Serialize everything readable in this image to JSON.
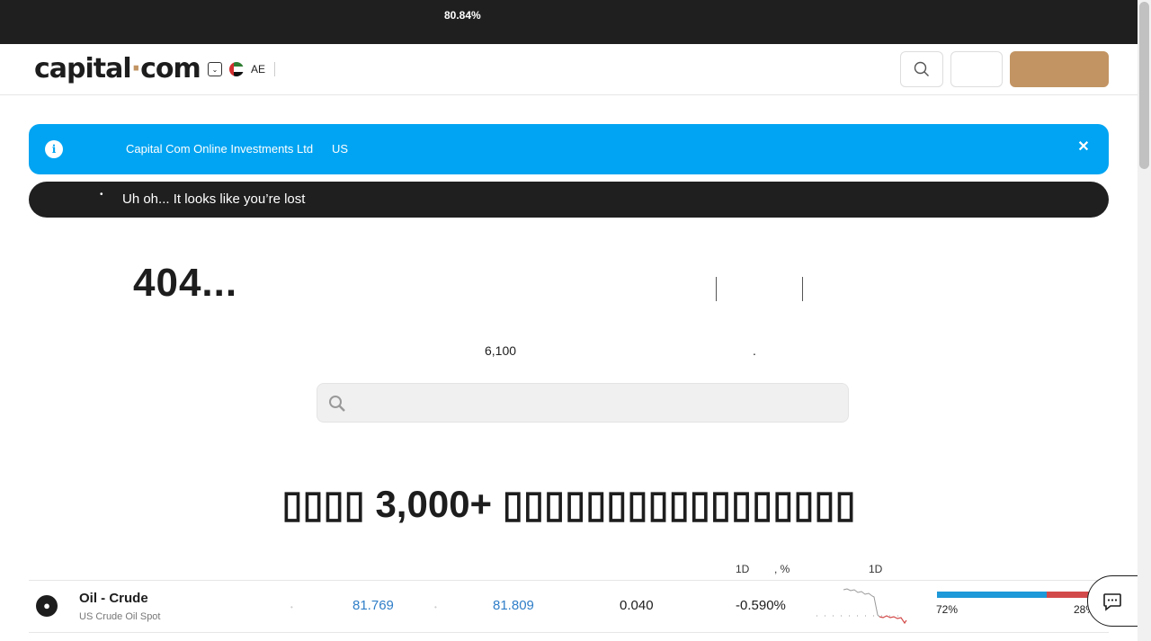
{
  "riskbar": {
    "percent": "80.84%"
  },
  "header": {
    "logo_main": "capital",
    "logo_dot": "·",
    "logo_tail": "com",
    "locale_code": "AE",
    "locale_chevron": "⌄"
  },
  "info_banner": {
    "icon": "i",
    "text": "Capital Com Online Investments Ltd",
    "country": "US",
    "close": "✕"
  },
  "breadcrumb": {
    "bullet": "•",
    "label": "Uh oh... It looks like you’re lost"
  },
  "error": {
    "heading": "404...",
    "count": "6,100",
    "period": "."
  },
  "markets": {
    "heading": "▯▯▯▯ 3,000+ ▯▯▯▯▯▯▯▯▯▯▯▯▯▯▯▯▯",
    "headers": {
      "change_1d": "1D",
      "change_pct": ", %",
      "chart_1d": "1D"
    },
    "rows": [
      {
        "icon": "💧",
        "name": "Oil - Crude",
        "subtitle": "US Crude Oil Spot",
        "sell": "81.769",
        "buy": "81.809",
        "spread": "0.040",
        "change": "-0.590%",
        "buyers_pct": "72%",
        "sellers_pct": "28%",
        "buyers_fraction": 0.72
      }
    ]
  },
  "colors": {
    "accent": "#c29463",
    "info_blue": "#00a4f2",
    "buy_blue": "#1d98d8",
    "sell_red": "#d34a4a",
    "price_blue": "#2f7ec8"
  }
}
